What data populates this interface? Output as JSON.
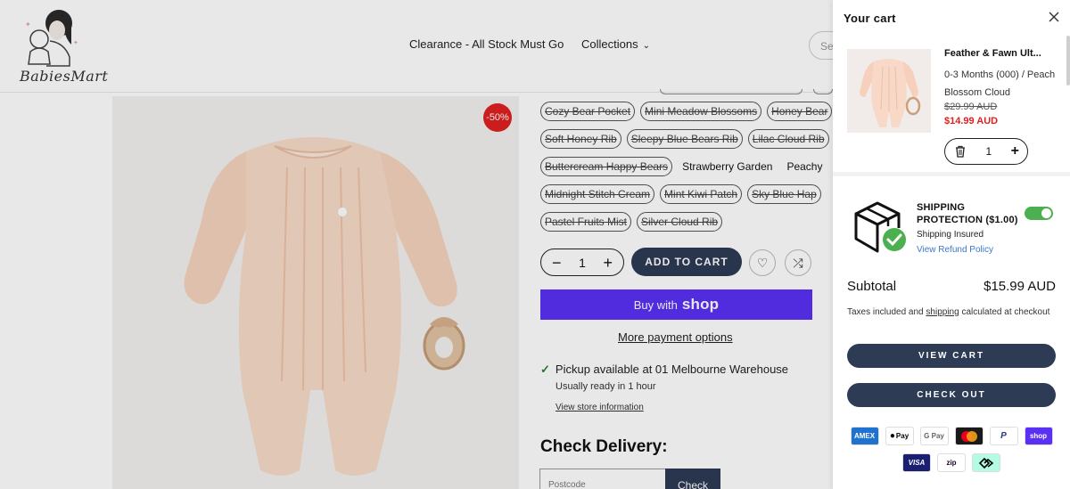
{
  "store": {
    "logo_text": "BabiesMart",
    "nav": {
      "clearance": "Clearance - All Stock Must Go",
      "collections": "Collections"
    },
    "search_placeholder": "Sea",
    "sale_badge": "-50%",
    "variants": [
      [
        {
          "label": "Cozy Bear Pocket",
          "soldout": true
        },
        {
          "label": "Mini Meadow Blossoms",
          "soldout": true
        },
        {
          "label": "Honey Bear",
          "soldout": true
        }
      ],
      [
        {
          "label": "Soft Honey Rib",
          "soldout": true
        },
        {
          "label": "Sleepy Blue Bears Rib",
          "soldout": true
        },
        {
          "label": "Lilac Cloud Rib",
          "soldout": true
        }
      ],
      [
        {
          "label": "Buttercream Happy Bears",
          "soldout": true
        },
        {
          "label": "Strawberry Garden",
          "soldout": false
        },
        {
          "label": "Peachy",
          "soldout": false
        }
      ],
      [
        {
          "label": "Midnight Stitch Cream",
          "soldout": true
        },
        {
          "label": "Mint Kiwi Patch",
          "soldout": true
        },
        {
          "label": "Sky Blue Hap",
          "soldout": true
        }
      ],
      [
        {
          "label": "Pastel Fruits Mist",
          "soldout": true
        },
        {
          "label": "Silver Cloud Rib",
          "soldout": true
        }
      ]
    ],
    "quantity": "1",
    "add_to_cart": "ADD TO CART",
    "buy_with": "Buy with",
    "shop_word": "shop",
    "more_payment": "More payment options",
    "pickup_text": "Pickup available at 01 Melbourne Warehouse",
    "pickup_ready": "Usually ready in 1 hour",
    "store_info": "View store information",
    "check_delivery_title": "Check Delivery:",
    "postcode_placeholder": "Postcode",
    "check_button": "Check"
  },
  "cart": {
    "title": "Your cart",
    "item": {
      "name": "Feather & Fawn Ult...",
      "variant": "0-3 Months (000) / Peach Blossom Cloud",
      "old_price": "$29.99 AUD",
      "price": "$14.99 AUD",
      "quantity": "1"
    },
    "shipping": {
      "title": "SHIPPING PROTECTION ($1.00)",
      "insured": "Shipping Insured",
      "refund_link": "View Refund Policy",
      "enabled": true,
      "toggle_color": "#4caf50"
    },
    "subtotal_label": "Subtotal",
    "subtotal_value": "$15.99 AUD",
    "tax_note_prefix": "Taxes included and",
    "tax_note_link": "shipping",
    "tax_note_suffix": "calculated at checkout",
    "view_cart": "VIEW CART",
    "checkout": "CHECK OUT",
    "payment_icons": [
      {
        "name": "amex-icon",
        "label": "AMEX",
        "bg": "#1f72cd",
        "fg": "#ffffff"
      },
      {
        "name": "apple-pay-icon",
        "label": "Pay",
        "bg": "#ffffff",
        "fg": "#000000"
      },
      {
        "name": "google-pay-icon",
        "label": "G Pay",
        "bg": "#ffffff",
        "fg": "#5f6368"
      },
      {
        "name": "mastercard-icon",
        "label": "",
        "bg": "#1a1a1a",
        "fg": "#ffffff"
      },
      {
        "name": "paypal-icon",
        "label": "P",
        "bg": "#ffffff",
        "fg": "#253b80"
      },
      {
        "name": "shop-pay-icon",
        "label": "shop",
        "bg": "#5a31f4",
        "fg": "#ffffff"
      },
      {
        "name": "visa-icon",
        "label": "VISA",
        "bg": "#1a1f71",
        "fg": "#ffffff"
      },
      {
        "name": "zip-icon",
        "label": "zip",
        "bg": "#ffffff",
        "fg": "#1a0826"
      },
      {
        "name": "afterpay-icon",
        "label": "",
        "bg": "#b2fce4",
        "fg": "#000000"
      }
    ]
  }
}
